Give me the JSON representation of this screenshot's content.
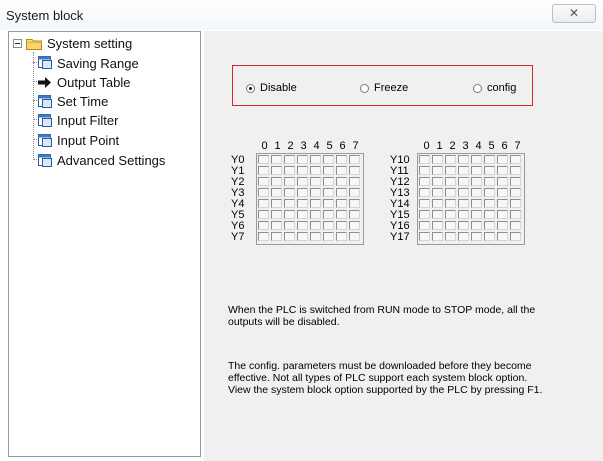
{
  "window": {
    "title": "System block",
    "close_glyph": "✕"
  },
  "tree": {
    "root_label": "System setting",
    "items": [
      {
        "label": "Saving Range",
        "icon": "window-icon"
      },
      {
        "label": "Output Table",
        "icon": "arrow-right-icon"
      },
      {
        "label": "Set Time",
        "icon": "window-icon"
      },
      {
        "label": "Input Filter",
        "icon": "window-icon"
      },
      {
        "label": "Input Point",
        "icon": "window-icon"
      },
      {
        "label": "Advanced Settings",
        "icon": "window-icon"
      }
    ],
    "selected": "Output Table"
  },
  "output_mode": {
    "options": [
      {
        "label": "Disable",
        "selected": true
      },
      {
        "label": "Freeze",
        "selected": false
      },
      {
        "label": "config",
        "selected": false
      }
    ],
    "box_color": "#d7262c"
  },
  "grids": [
    {
      "bits": [
        "0",
        "1",
        "2",
        "3",
        "4",
        "5",
        "6",
        "7"
      ],
      "rows": [
        "Y0",
        "Y1",
        "Y2",
        "Y3",
        "Y4",
        "Y5",
        "Y6",
        "Y7"
      ]
    },
    {
      "bits": [
        "0",
        "1",
        "2",
        "3",
        "4",
        "5",
        "6",
        "7"
      ],
      "rows": [
        "Y10",
        "Y11",
        "Y12",
        "Y13",
        "Y14",
        "Y15",
        "Y16",
        "Y17"
      ]
    }
  ],
  "messages": {
    "line1": "When the PLC is switched from RUN mode to STOP mode, all the",
    "line2": "outputs will be disabled.",
    "line3": "The config. parameters must be downloaded before they become",
    "line4": "effective. Not all types of PLC support each system block option.",
    "line5": "View the system block option supported by the PLC by pressing F1."
  }
}
